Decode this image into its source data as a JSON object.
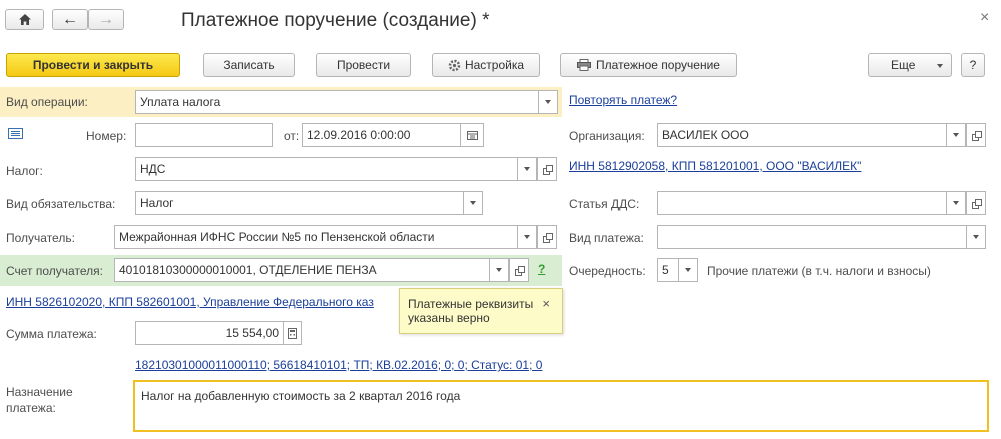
{
  "window": {
    "title": "Платежное поручение (создание) *",
    "close_glyph": "×"
  },
  "nav": {
    "home_icon": "home-icon",
    "back_glyph": "←",
    "forward_glyph": "→"
  },
  "toolbar": {
    "post_and_close_label": "Провести и закрыть",
    "save_label": "Записать",
    "post_label": "Провести",
    "settings_label": "Настройка",
    "print_label": "Платежное поручение",
    "more_label": "Еще",
    "help_label": "?"
  },
  "form": {
    "operation_type": {
      "label": "Вид операции:",
      "value": "Уплата налога"
    },
    "repeat_payment_link": "Повторять платеж?",
    "number": {
      "label": "Номер:",
      "value": ""
    },
    "date": {
      "label": "от:",
      "value": "12.09.2016  0:00:00"
    },
    "organization": {
      "label": "Организация:",
      "value": "ВАСИЛЕК ООО"
    },
    "org_details_link": "ИНН 5812902058, КПП 581201001, ООО \"ВАСИЛЕК\"",
    "tax": {
      "label": "Налог:",
      "value": "НДС"
    },
    "obligation_type": {
      "label": "Вид обязательства:",
      "value": "Налог"
    },
    "cash_flow_item": {
      "label": "Статья ДДС:",
      "value": ""
    },
    "recipient": {
      "label": "Получатель:",
      "value": "Межрайонная ИФНС России №5 по Пензенской области"
    },
    "payment_type": {
      "label": "Вид платежа:",
      "value": ""
    },
    "recipient_account": {
      "label": "Счет получателя:",
      "value": "40101810300000010001, ОТДЕЛЕНИЕ ПЕНЗА"
    },
    "help_mark": "?",
    "priority": {
      "label": "Очередность:",
      "value": "5",
      "description": "Прочие платежи (в т.ч. налоги и взносы)"
    },
    "recipient_details_link": "ИНН 5826102020, КПП 582601001, Управление Федерального каз",
    "tooltip": {
      "line1": "Платежные реквизиты",
      "line2": "указаны верно",
      "close_glyph": "×"
    },
    "amount": {
      "label": "Сумма платежа:",
      "value": "15 554,00"
    },
    "kbk_link": "18210301000011000110; 56618410101; ТП; КВ.02.2016; 0; 0; Статус: 01; 0",
    "purpose": {
      "label_line1": "Назначение",
      "label_line2": "платежа:",
      "value": "Налог на добавленную стоимость за 2 квартал 2016 года"
    }
  },
  "colors": {
    "primary_button": "#f5c914",
    "highlight_yellow": "#fcefc3",
    "highlight_green": "#d9edd3",
    "link": "#1a3e9a",
    "purpose_border": "#f0c020"
  }
}
